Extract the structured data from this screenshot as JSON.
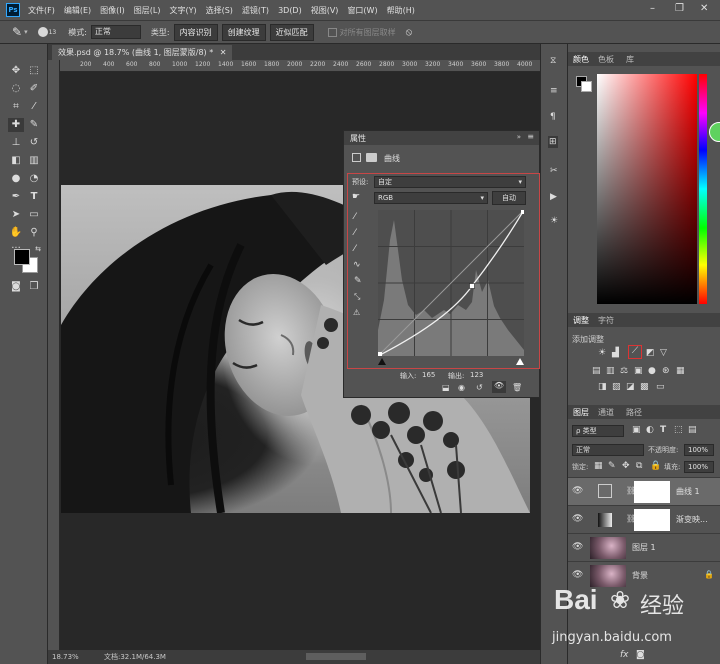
{
  "app": {
    "logo": "Ps",
    "menu": [
      "文件(F)",
      "编辑(E)",
      "图像(I)",
      "图层(L)",
      "文字(Y)",
      "选择(S)",
      "滤镜(T)",
      "3D(D)",
      "视图(V)",
      "窗口(W)",
      "帮助(H)"
    ],
    "window_controls": {
      "minimize": "–",
      "restore": "❐",
      "close": "✕"
    }
  },
  "options_bar": {
    "brush_size": "13",
    "mode_label": "模式:",
    "mode_value": "正常",
    "type_label": "类型:",
    "type_buttons": [
      "内容识别",
      "创建纹理",
      "近似匹配"
    ],
    "sample_all_layers": "对所有图层取样"
  },
  "document": {
    "tab_title": "效果.psd @ 18.7% (曲线 1, 图层蒙版/8) *",
    "ruler_marks": [
      "200",
      "400",
      "600",
      "800",
      "1000",
      "1200",
      "1400",
      "1600",
      "1800",
      "2000",
      "2200",
      "2400",
      "2600",
      "2800",
      "3000",
      "3200",
      "3400",
      "3600",
      "3800",
      "4000",
      "4200"
    ],
    "zoom": "18.73%",
    "doc_info": "文档:32.1M/64.3M"
  },
  "properties": {
    "title": "属性",
    "panel_name": "曲线",
    "preset_label": "预设:",
    "preset_value": "自定",
    "channel_value": "RGB",
    "auto_button": "自动",
    "input_label": "输入:",
    "input_value": "165",
    "output_label": "输出:",
    "output_value": "123"
  },
  "color_panel": {
    "tabs": [
      "颜色",
      "色板",
      "库"
    ],
    "foreground": "#000000",
    "background": "#ffffff"
  },
  "adjust_panel": {
    "tabs": [
      "调整",
      "字符"
    ],
    "add_label": "添加调整"
  },
  "layers_panel": {
    "tabs": [
      "图层",
      "通道",
      "路径"
    ],
    "filter_value": "ρ 类型",
    "blend_value": "正常",
    "opacity_label": "不透明度:",
    "opacity_value": "100%",
    "lock_label": "锁定:",
    "fill_label": "填充:",
    "fill_value": "100%",
    "layers": [
      {
        "name": "曲线 1"
      },
      {
        "name": "渐变映..."
      },
      {
        "name": "图层 1"
      },
      {
        "name": "背景"
      }
    ]
  },
  "watermark": {
    "brand": "Bai",
    "brand_cn": "经验",
    "url": "jingyan.baidu.com"
  }
}
